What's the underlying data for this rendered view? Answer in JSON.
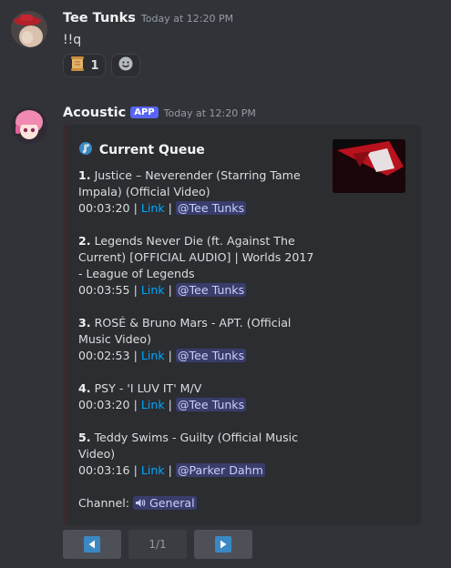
{
  "message1": {
    "username": "Tee Tunks",
    "timestamp": "Today at 12:20 PM",
    "content": "!!q",
    "reactions": [
      {
        "icon": "scroll-icon",
        "count": "1"
      },
      {
        "icon": "add-reaction-smiley-icon"
      }
    ]
  },
  "message2": {
    "username": "Acoustic",
    "badge": "APP",
    "timestamp": "Today at 12:20 PM",
    "embed": {
      "title_icon": "music-note-icon",
      "title": "Current Queue",
      "entries": [
        {
          "num": "1.",
          "title": "Justice – Neverender (Starring Tame Impala) (Official Video)",
          "duration": "00:03:20",
          "link": "Link",
          "user": "@Tee Tunks"
        },
        {
          "num": "2.",
          "title": "Legends Never Die (ft. Against The Current) [OFFICIAL AUDIO] | Worlds 2017 - League of Legends",
          "duration": "00:03:55",
          "link": "Link",
          "user": "@Tee Tunks"
        },
        {
          "num": "3.",
          "title": "ROSÉ & Bruno Mars - APT. (Official Music Video)",
          "duration": "00:02:53",
          "link": "Link",
          "user": "@Tee Tunks"
        },
        {
          "num": "4.",
          "title": "PSY - 'I LUV IT' M/V",
          "duration": "00:03:20",
          "link": "Link",
          "user": "@Tee Tunks"
        },
        {
          "num": "5.",
          "title": "Teddy Swims - Guilty (Official Music Video)",
          "duration": "00:03:16",
          "link": "Link",
          "user": "@Parker Dahm"
        }
      ],
      "channel_label": "Channel:",
      "channel_icon": "speaker-icon",
      "channel_name": "General"
    },
    "buttons": {
      "prev_icon": "left-arrow-icon",
      "page": "1/1",
      "next_icon": "right-arrow-icon"
    }
  },
  "colors": {
    "background": "#313338",
    "embed_background": "#2b2d31",
    "link": "#00a8fc",
    "mention": "#c9cdfb",
    "app_badge": "#5865f2",
    "arrow_button": "#3b88c3"
  }
}
